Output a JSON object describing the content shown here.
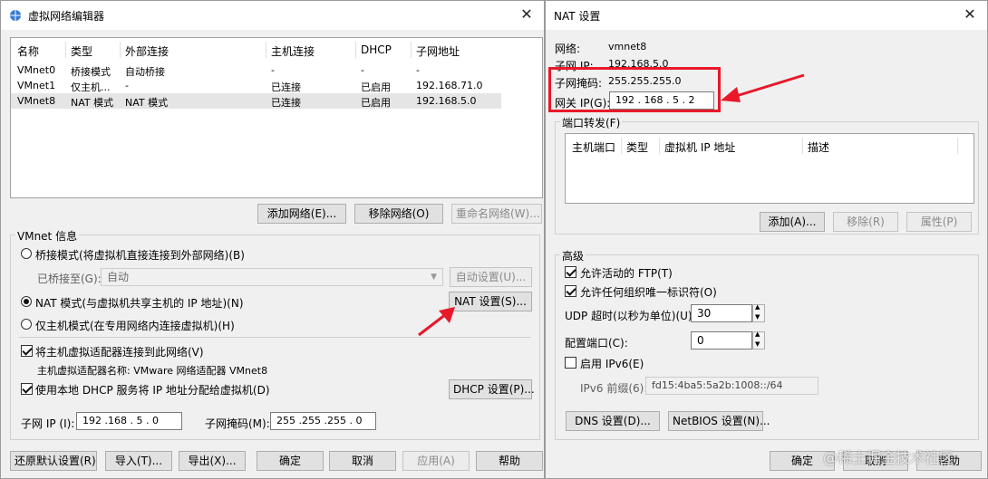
{
  "left_window": {
    "title": "虚拟网络编辑器",
    "table": {
      "headers": [
        "名称",
        "类型",
        "外部连接",
        "主机连接",
        "DHCP",
        "子网地址"
      ],
      "rows": [
        [
          "VMnet0",
          "桥接模式",
          "自动桥接",
          "-",
          "-",
          "-"
        ],
        [
          "VMnet1",
          "仅主机...",
          "-",
          "已连接",
          "已启用",
          "192.168.71.0"
        ],
        [
          "VMnet8",
          "NAT 模式",
          "NAT 模式",
          "已连接",
          "已启用",
          "192.168.5.0"
        ]
      ]
    },
    "buttons": {
      "add_network": "添加网络(E)...",
      "remove_network": "移除网络(O)",
      "rename_network": "重命名网络(W)..."
    },
    "vmnet_info": {
      "title": "VMnet 信息",
      "bridged_mode": "桥接模式(将虚拟机直接连接到外部网络)(B)",
      "bridged_to_label": "已桥接至(G):",
      "bridged_to_value": "自动",
      "auto_settings": "自动设置(U)...",
      "nat_mode": "NAT 模式(与虚拟机共享主机的 IP 地址)(N)",
      "nat_settings": "NAT 设置(S)...",
      "host_only_mode": "仅主机模式(在专用网络内连接虚拟机)(H)",
      "connect_adapter": "将主机虚拟适配器连接到此网络(V)",
      "adapter_name": "主机虚拟适配器名称: VMware 网络适配器 VMnet8",
      "use_dhcp": "使用本地 DHCP 服务将 IP 地址分配给虚拟机(D)",
      "dhcp_settings": "DHCP 设置(P)...",
      "subnet_ip_label": "子网 IP (I):",
      "subnet_ip_value": "192 .168 .  5  .  0",
      "subnet_mask_label": "子网掩码(M):",
      "subnet_mask_value": "255 .255 .255 .  0"
    },
    "footer": {
      "restore": "还原默认设置(R)",
      "import": "导入(T)...",
      "export": "导出(X)...",
      "ok": "确定",
      "cancel": "取消",
      "apply": "应用(A)",
      "help": "帮助"
    }
  },
  "right_window": {
    "title": "NAT 设置",
    "network_label": "网络:",
    "network_value": "vmnet8",
    "subnet_ip_label": "子网 IP:",
    "subnet_ip_value": "192.168.5.0",
    "subnet_mask_label": "子网掩码:",
    "subnet_mask_value": "255.255.255.0",
    "gateway_label": "网关 IP(G):",
    "gateway_value": "192 . 168 .  5  .  2",
    "port_forwarding": {
      "title": "端口转发(F)",
      "headers": [
        "主机端口",
        "类型",
        "虚拟机 IP 地址",
        "描述"
      ],
      "add": "添加(A)...",
      "remove": "移除(R)",
      "properties": "属性(P)"
    },
    "advanced": {
      "title": "高级",
      "allow_ftp": "允许活动的 FTP(T)",
      "allow_unique_id": "允许任何组织唯一标识符(O)",
      "udp_timeout_label": "UDP 超时(以秒为单位)(U):",
      "udp_timeout_value": "30",
      "config_port_label": "配置端口(C):",
      "config_port_value": "0",
      "enable_ipv6": "启用 IPv6(E)",
      "ipv6_prefix_label": "IPv6 前缀(6):",
      "ipv6_prefix_value": "fd15:4ba5:5a2b:1008::/64",
      "dns_settings": "DNS 设置(D)...",
      "netbios_settings": "NetBIOS 设置(N)..."
    },
    "footer": {
      "ok": "确定",
      "cancel": "取消",
      "help": "帮助"
    }
  },
  "watermark": "@稀土掘金技术社区",
  "colors": {
    "highlight": "#e8182a",
    "selected_row": "#e5e5e5"
  }
}
